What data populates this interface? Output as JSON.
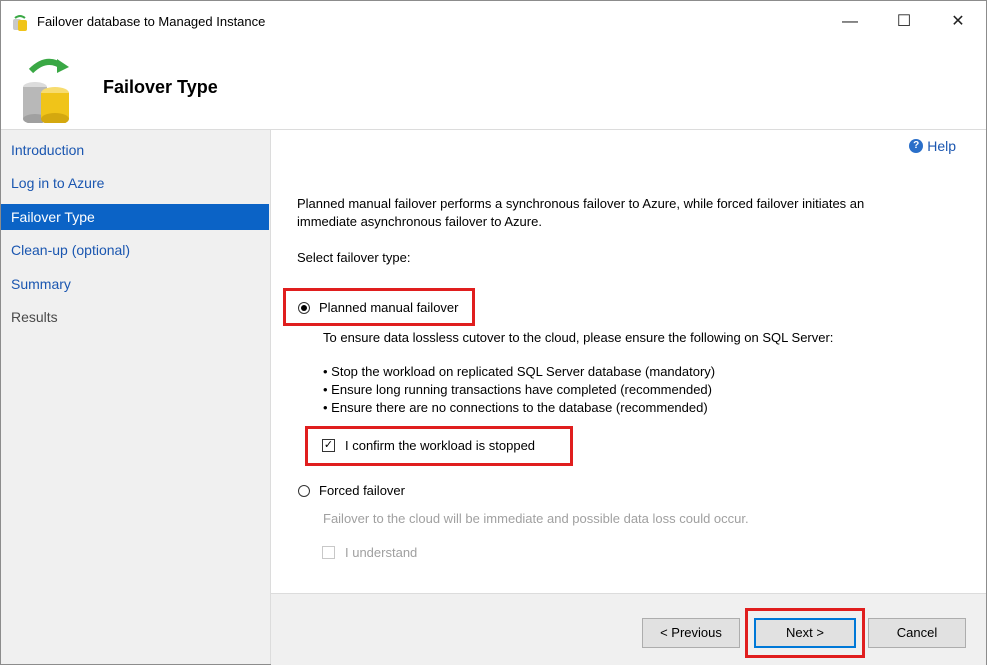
{
  "window": {
    "title": "Failover database to Managed Instance",
    "minimize_glyph": "—",
    "maximize_glyph": "☐",
    "close_glyph": "✕"
  },
  "header": {
    "title": "Failover Type",
    "icon": "database-sync-icon"
  },
  "sidebar": {
    "items": [
      {
        "label": "Introduction",
        "state": "link"
      },
      {
        "label": "Log in to Azure",
        "state": "link"
      },
      {
        "label": "Failover Type",
        "state": "active"
      },
      {
        "label": "Clean-up (optional)",
        "state": "link"
      },
      {
        "label": "Summary",
        "state": "link"
      },
      {
        "label": "Results",
        "state": "disabled"
      }
    ]
  },
  "content": {
    "help_label": "Help",
    "intro_line1": "Planned manual failover performs a synchronous failover to Azure, while forced failover initiates an",
    "intro_line2": "immediate asynchronous failover to Azure.",
    "select_label": "Select failover type:",
    "planned": {
      "label": "Planned manual failover",
      "selected": true,
      "description": "To ensure data lossless cutover to the cloud, please ensure the following on SQL Server:",
      "bullets": [
        "• Stop the workload on replicated SQL Server database (mandatory)",
        "• Ensure long running transactions have completed (recommended)",
        "• Ensure there are no connections to the database (recommended)"
      ],
      "confirm_label": "I confirm the workload is stopped",
      "confirm_checked": true
    },
    "forced": {
      "label": "Forced failover",
      "selected": false,
      "description": "Failover to the cloud will be immediate and possible data loss could occur.",
      "understand_label": "I understand",
      "understand_checked": false
    }
  },
  "footer": {
    "previous_label": "< Previous",
    "next_label": "Next >",
    "cancel_label": "Cancel"
  },
  "colors": {
    "active_nav": "#0b63c6",
    "link": "#1a56b0",
    "highlight": "#e01e1e"
  }
}
